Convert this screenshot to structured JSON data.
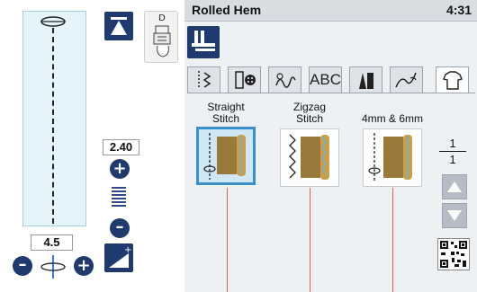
{
  "left_panel": {
    "presser_foot_letter": "D",
    "stitch_width": "2.40",
    "stitch_length": "4.5",
    "icons": {
      "top_button": "needle-up-icon",
      "foot_card": "presser-foot-icon",
      "width_plus": "plus-icon",
      "width_minus": "minus-icon",
      "length_minus": "minus-icon",
      "length_plus": "plus-icon",
      "density": "density-icon",
      "bottom_button": "triangle-wedge-icon"
    }
  },
  "header": {
    "title": "Rolled Hem",
    "clock": "4:31"
  },
  "tabs": [
    {
      "icon": "utility-stitch-icon",
      "label": ""
    },
    {
      "icon": "buttonhole-icon",
      "label": ""
    },
    {
      "icon": "decorative-stitch-icon",
      "label": ""
    },
    {
      "icon": "alphabet-icon",
      "label": "ABC"
    },
    {
      "icon": "satin-stitch-icon",
      "label": ""
    },
    {
      "icon": "floral-stitch-icon",
      "label": ""
    },
    {
      "icon": "shirt-icon",
      "label": ""
    }
  ],
  "stitches": [
    {
      "label_line1": "Straight",
      "label_line2": "Stitch",
      "selected": true
    },
    {
      "label_line1": "Zigzag",
      "label_line2": "Stitch",
      "selected": false
    },
    {
      "label_line1": "4mm & 6mm",
      "label_line2": "",
      "selected": false
    }
  ],
  "pagination": {
    "current": "1",
    "total": "1"
  },
  "colors": {
    "accent_dark": "#1f3a6e",
    "selected_border": "#3a8fd0",
    "guide_line": "#e25a5a",
    "fabric_brown": "#9a7a3a"
  }
}
